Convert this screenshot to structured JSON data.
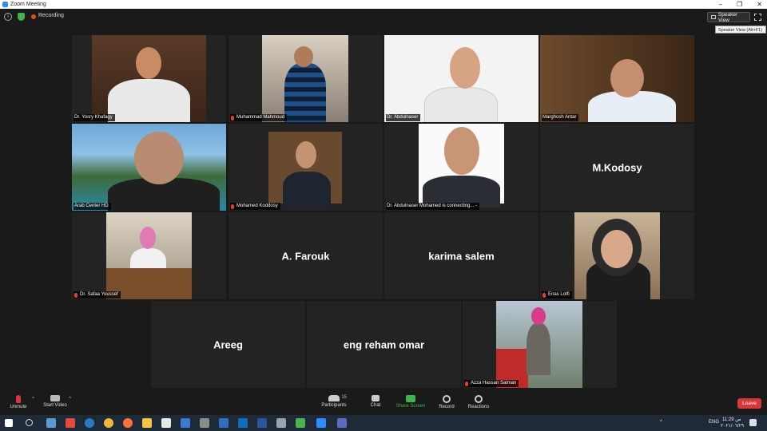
{
  "window": {
    "title": "Zoom Meeting",
    "controls": [
      "–",
      "❐",
      "✕"
    ]
  },
  "topbar": {
    "recording_label": "Recording",
    "speaker_view_label": "Speaker View",
    "tooltip": "Speaker View (Alt+F1)"
  },
  "participants": [
    {
      "name": "Dr. Yosry Khafagy"
    },
    {
      "name": "Muhammad Mahmoud"
    },
    {
      "name": "Dr. Abdulnaser"
    },
    {
      "name": "Marghosh Antar"
    },
    {
      "name": "Arab Center HD"
    },
    {
      "name": "Mohamed Koddosy"
    },
    {
      "name": "Dr. Abdulnaser Mohamed is connecting... -"
    },
    {
      "name": "M.Kodosy",
      "display": "M.Kodosy"
    },
    {
      "name": "Dr. Safaa Youssef"
    },
    {
      "name": "A. Farouk",
      "display": "A. Farouk"
    },
    {
      "name": "karima salem",
      "display": "karima salem"
    },
    {
      "name": "Enas Lotfi"
    },
    {
      "name": "Areeg",
      "display": "Areeg"
    },
    {
      "name": "eng reham omar",
      "display": "eng reham omar"
    },
    {
      "name": "Azza Hassan Salman"
    }
  ],
  "toolbar": {
    "unmute": "Unmute",
    "start_video": "Start Video",
    "participants": "Participants",
    "participants_count": "15",
    "chat": "Chat",
    "share_screen": "Share Screen",
    "record": "Record",
    "reactions": "Reactions",
    "leave": "Leave"
  },
  "taskbar": {
    "language": "ENG",
    "time": "11:29 ص",
    "date": "٢٠٢١/٠٦/٢٩"
  },
  "colors": {
    "accent_green": "#3cb64a",
    "leave_red": "#d93737",
    "active_speaker": "#e6d44a"
  }
}
